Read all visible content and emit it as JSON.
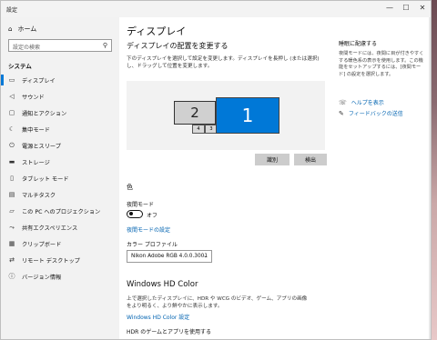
{
  "window": {
    "title": "設定",
    "min": "—",
    "max": "☐",
    "close": "✕"
  },
  "sidebar": {
    "home": "ホーム",
    "search_placeholder": "設定の検索",
    "section": "システム",
    "items": [
      {
        "label": "ディスプレイ",
        "icon": "monitor-icon",
        "glyph": "▭"
      },
      {
        "label": "サウンド",
        "icon": "speaker-icon",
        "glyph": "◁"
      },
      {
        "label": "通知とアクション",
        "icon": "notification-icon",
        "glyph": "▢"
      },
      {
        "label": "集中モード",
        "icon": "moon-icon",
        "glyph": "☾"
      },
      {
        "label": "電源とスリープ",
        "icon": "power-icon",
        "glyph": "⏻"
      },
      {
        "label": "ストレージ",
        "icon": "storage-icon",
        "glyph": "▬"
      },
      {
        "label": "タブレット モード",
        "icon": "tablet-icon",
        "glyph": "▯"
      },
      {
        "label": "マルチタスク",
        "icon": "multitask-icon",
        "glyph": "▤"
      },
      {
        "label": "この PC へのプロジェクション",
        "icon": "projection-icon",
        "glyph": "▱"
      },
      {
        "label": "共有エクスペリエンス",
        "icon": "share-icon",
        "glyph": "⤳"
      },
      {
        "label": "クリップボード",
        "icon": "clipboard-icon",
        "glyph": "▦"
      },
      {
        "label": "リモート デスクトップ",
        "icon": "remote-icon",
        "glyph": "⇄"
      },
      {
        "label": "バージョン情報",
        "icon": "info-icon",
        "glyph": "ⓘ"
      }
    ]
  },
  "main": {
    "title": "ディスプレイ",
    "subtitle": "ディスプレイの配置を変更する",
    "description": "下のディスプレイを選択して設定を変更します。ディスプレイを長押し (または選択) し、ドラッグして位置を変更します。",
    "monitors": {
      "m1": "1",
      "m2": "2",
      "m3": "3",
      "m4": "4"
    },
    "identify_button": "識別",
    "detect_button": "検出",
    "color_heading": "色",
    "night_mode_label": "夜間モード",
    "night_mode_state": "オフ",
    "night_mode_link": "夜間モードの設定",
    "color_profile_label": "カラー プロファイル",
    "color_profile_value": "Nikon Adobe RGB 4.0.0.3001",
    "hd_heading": "Windows HD Color",
    "hd_description": "上で選択したディスプレイに、HDR や WCG のビデオ、ゲーム、アプリの画像をより明るく、より鮮やかに表示します。",
    "hd_link": "Windows HD Color 設定",
    "hdr_label": "HDR のゲームとアプリを使用する"
  },
  "right_panel": {
    "heading": "睡眠に配慮する",
    "text": "夜間モードには、夜間に目が付きやすくする暖色系の表示を使用します。この機能をセットアップするには、[夜間モード] の設定を選択します。",
    "help": "ヘルプを表示",
    "feedback": "フィードバックの送信"
  }
}
